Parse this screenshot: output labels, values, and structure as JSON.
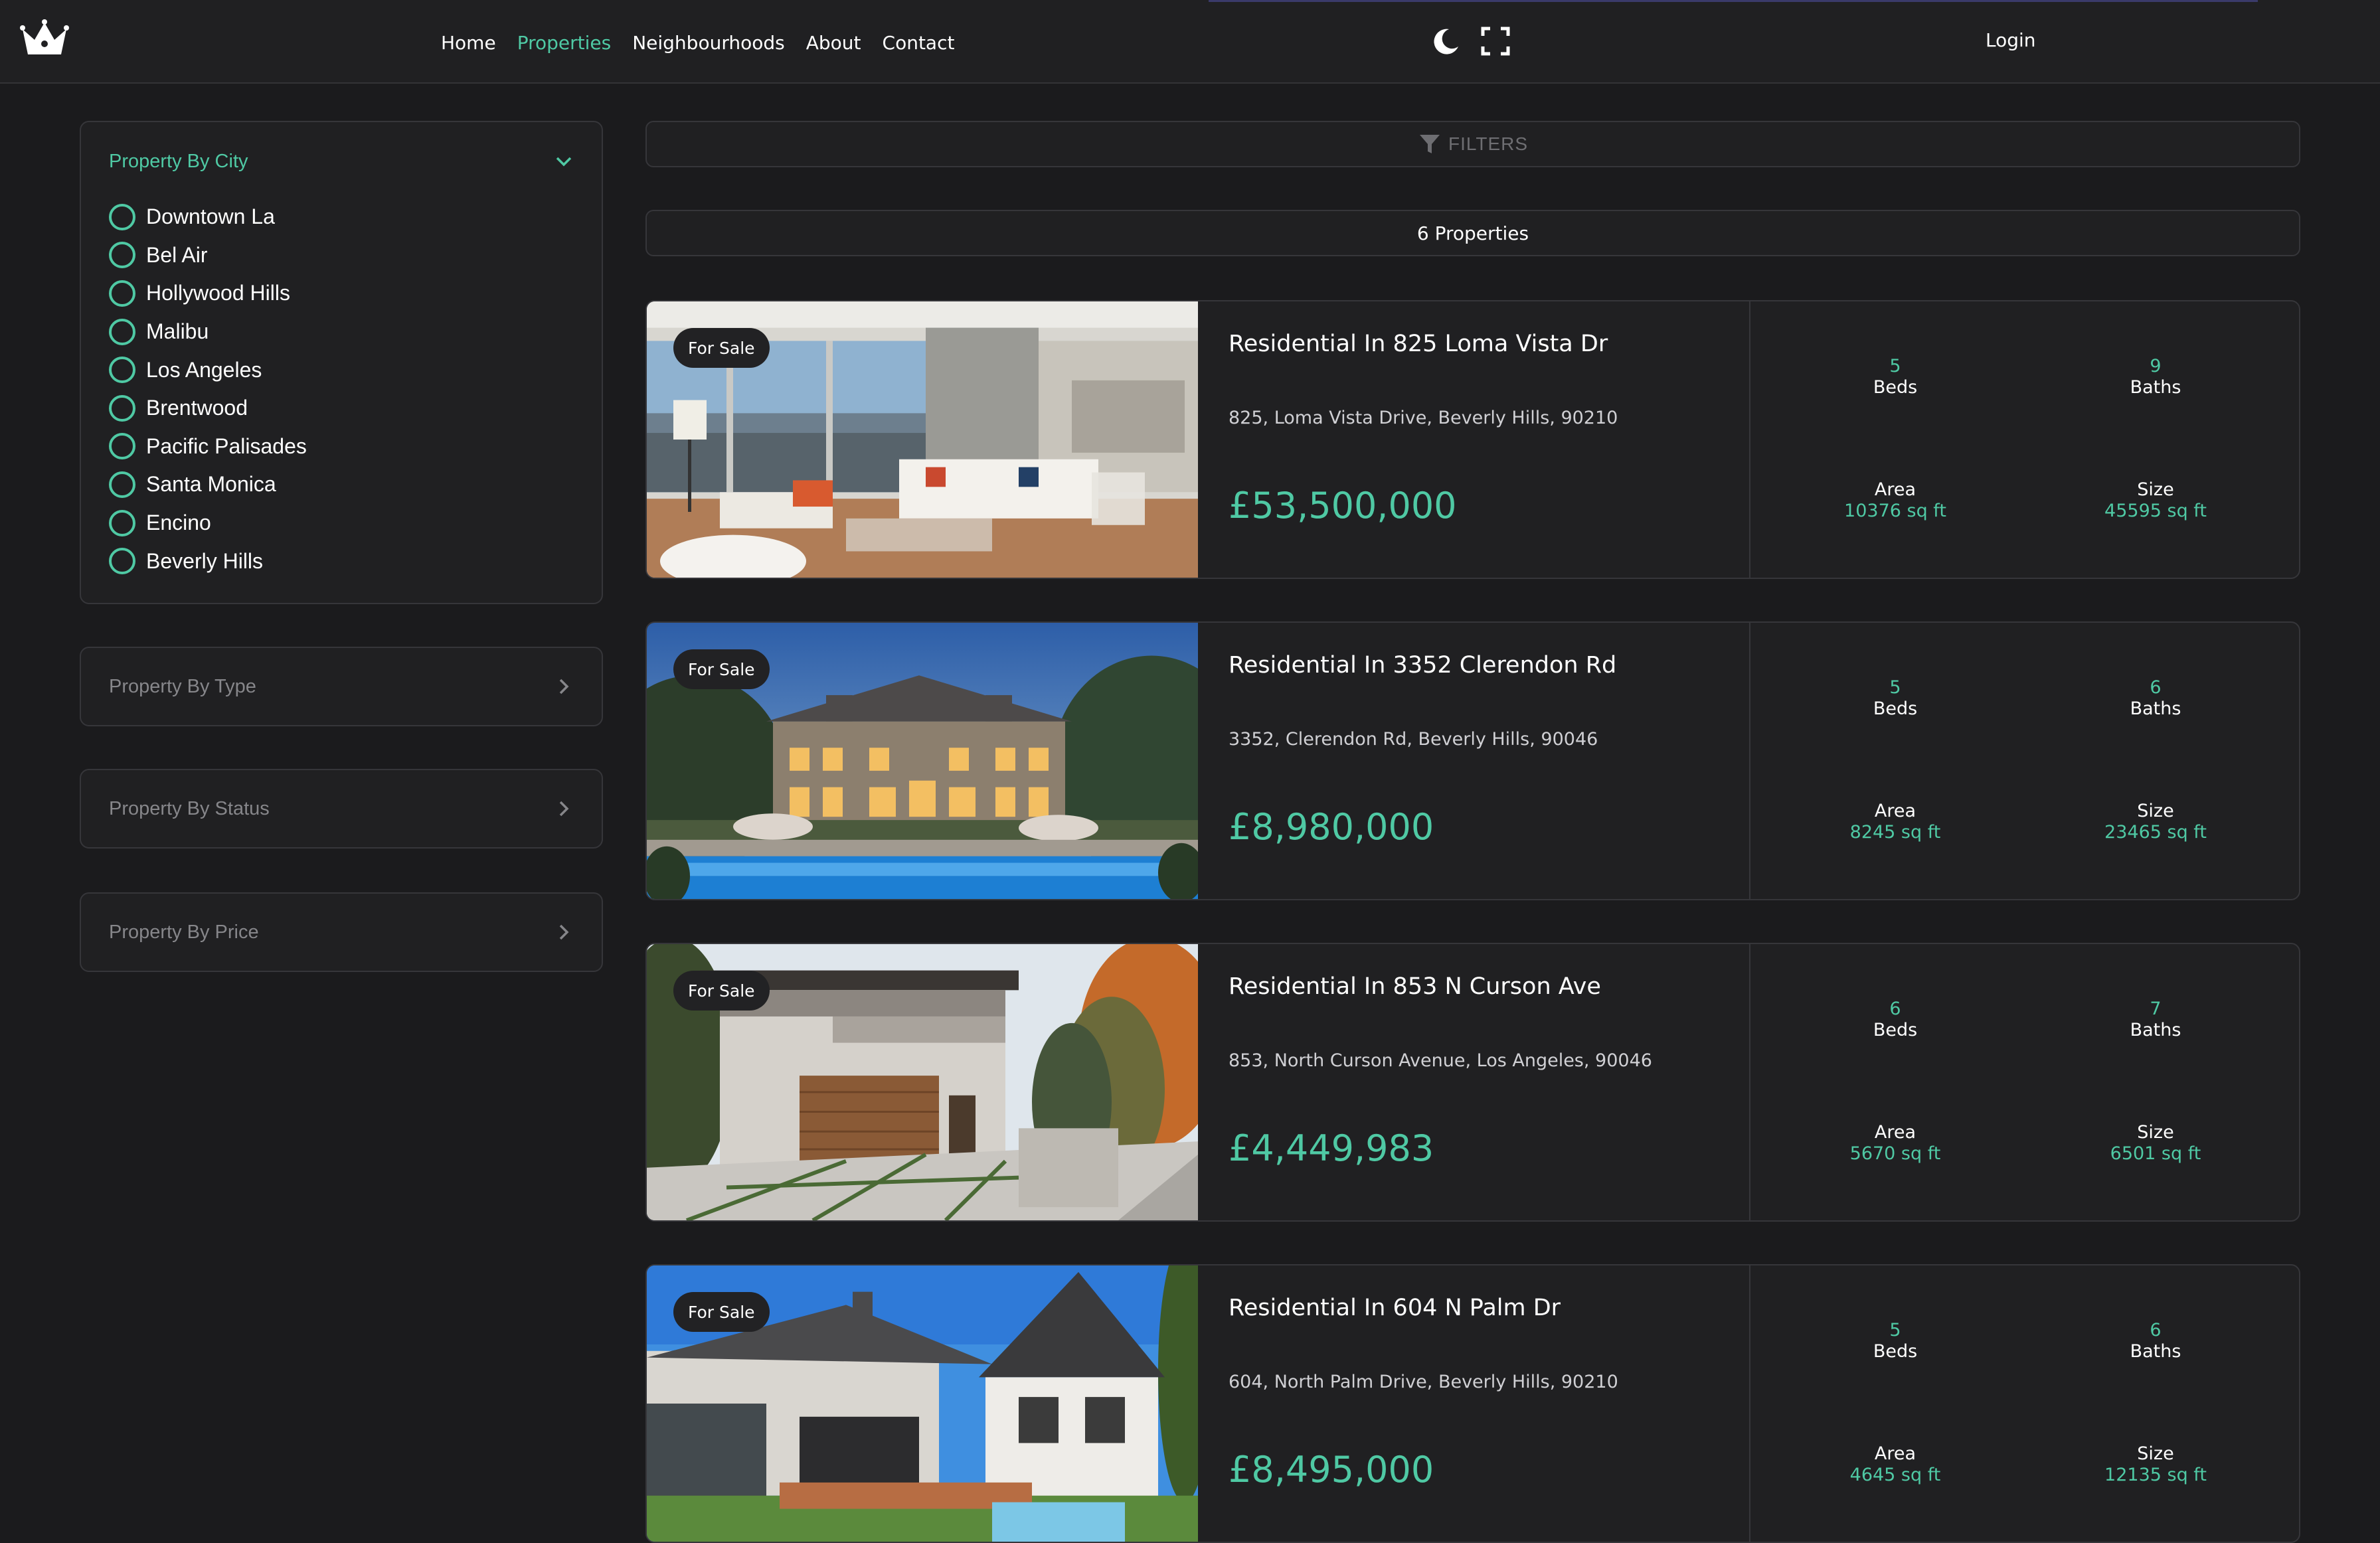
{
  "nav": {
    "links": [
      "Home",
      "Properties",
      "Neighbourhoods",
      "About",
      "Contact"
    ],
    "active": "Properties",
    "login": "Login",
    "icons": [
      "crown-logo-icon",
      "moon-icon",
      "fullscreen-icon"
    ]
  },
  "sidebar": {
    "city": {
      "title": "Property By City",
      "items": [
        "Downtown La",
        "Bel Air",
        "Hollywood Hills",
        "Malibu",
        "Los Angeles",
        "Brentwood",
        "Pacific Palisades",
        "Santa Monica",
        "Encino",
        "Beverly Hills"
      ]
    },
    "type_title": "Property By Type",
    "status_title": "Property By Status",
    "price_title": "Property By Price"
  },
  "filters_label": "FILTERS",
  "count_label": "6 Properties",
  "labels": {
    "beds": "Beds",
    "baths": "Baths",
    "area": "Area",
    "size": "Size"
  },
  "accent_color": "#4fc9a4",
  "properties": [
    {
      "badge": "For Sale",
      "title": "Residential In 825 Loma Vista Dr",
      "address": "825, Loma Vista Drive, Beverly Hills, 90210",
      "price": "£53,500,000",
      "beds": "5",
      "baths": "9",
      "area": "10376 sq ft",
      "size": "45595 sq ft"
    },
    {
      "badge": "For Sale",
      "title": "Residential In 3352 Clerendon Rd",
      "address": "3352, Clerendon Rd, Beverly Hills, 90046",
      "price": "£8,980,000",
      "beds": "5",
      "baths": "6",
      "area": "8245 sq ft",
      "size": "23465 sq ft"
    },
    {
      "badge": "For Sale",
      "title": "Residential In 853 N Curson Ave",
      "address": "853, North Curson Avenue, Los Angeles, 90046",
      "price": "£4,449,983",
      "beds": "6",
      "baths": "7",
      "area": "5670 sq ft",
      "size": "6501 sq ft"
    },
    {
      "badge": "For Sale",
      "title": "Residential In 604 N Palm Dr",
      "address": "604, North Palm Drive, Beverly Hills, 90210",
      "price": "£8,495,000",
      "beds": "5",
      "baths": "6",
      "area": "4645 sq ft",
      "size": "12135 sq ft"
    }
  ]
}
